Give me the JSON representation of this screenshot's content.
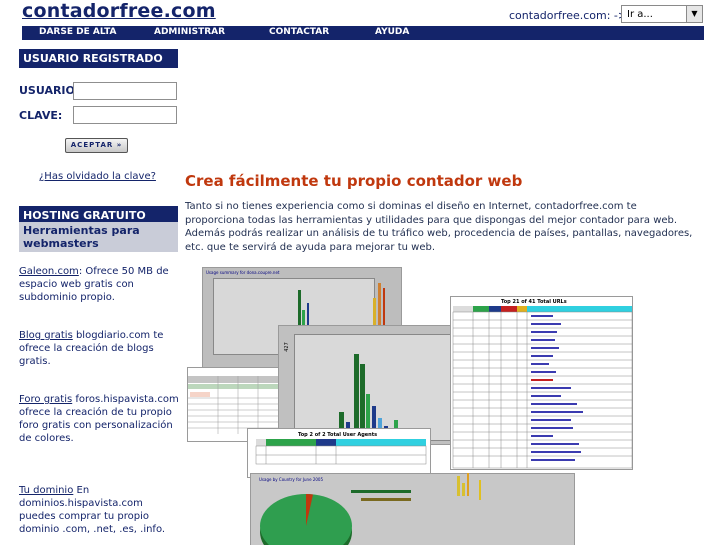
{
  "header": {
    "logo": "contadorfree.com",
    "goto_label": "contadorfree.com: ->",
    "goto_select_value": "Ir a..."
  },
  "nav": {
    "items": [
      "DARSE DE ALTA",
      "ADMINISTRAR",
      "CONTACTAR",
      "AYUDA"
    ]
  },
  "login": {
    "heading": "USUARIO REGISTRADO",
    "user_label": "USUARIO:",
    "password_label": "CLAVE:",
    "button": "ACEPTAR »",
    "forgot": "¿Has olvidado la clave?"
  },
  "hosting": {
    "heading": "HOSTING GRATUITO",
    "subheading": "Herramientas para webmasters",
    "items": [
      {
        "link": "Galeon.com",
        "text": ": Ofrece 50 MB de espacio web gratis con subdominio propio."
      },
      {
        "link": "Blog gratis",
        "text": " blogdiario.com te ofrece la creación de blogs gratis."
      },
      {
        "link": "Foro gratis",
        "text": " foros.hispavista.com ofrece la creación de tu propio foro gratis con personalización de colores."
      },
      {
        "link": "Tu dominio",
        "text": " En dominios.hispavista.com puedes comprar tu propio dominio .com, .net, .es, .info."
      }
    ]
  },
  "main": {
    "title": "Crea fácilmente tu propio contador web",
    "text": "Tanto si no tienes experiencia como si dominas el diseño en Internet, contadorfree.com te proporciona todas las herramientas y utilidades para que dispongas del mejor contador para web. Además podrás realizar un análisis de tu tráfico web, procedencia de países, pantallas, navegadores, etc. que te servirá de ayuda para mejorar tu web."
  },
  "screenshots": {
    "urls_title": "Top 21 of 41 Total URLs",
    "agents_title": "Top 2 of 2 Total User Agents",
    "country_title": "Usage by Country for June 2005",
    "daily_title": "Usage summary for dona.coupre.net",
    "axis_value": "427"
  },
  "colors": {
    "brand": "#14246a",
    "accent_title": "#c0380e"
  }
}
